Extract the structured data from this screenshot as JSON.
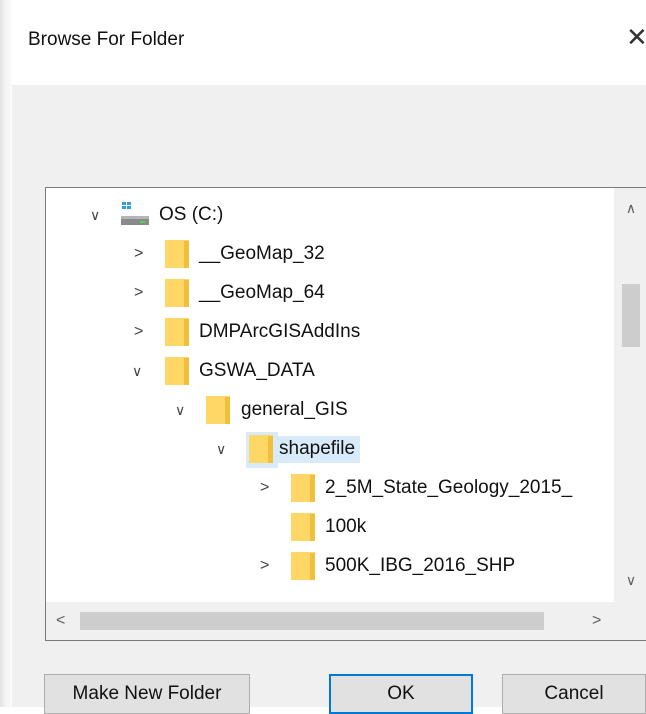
{
  "dialog": {
    "title": "Browse For Folder"
  },
  "tree": {
    "drive": {
      "label": "OS (C:)"
    },
    "items": [
      {
        "label": "__GeoMap_32"
      },
      {
        "label": "__GeoMap_64"
      },
      {
        "label": "DMPArcGISAddIns"
      },
      {
        "label": "GSWA_DATA"
      },
      {
        "label": "general_GIS"
      },
      {
        "label": "shapefile",
        "selected": true
      },
      {
        "label": "2_5M_State_Geology_2015_"
      },
      {
        "label": "100k"
      },
      {
        "label": "500K_IBG_2016_SHP"
      }
    ]
  },
  "buttons": {
    "new_folder": "Make New Folder",
    "ok": "OK",
    "cancel": "Cancel"
  },
  "icons": {
    "folder": "folder-icon",
    "drive": "drive-icon",
    "expand": "chevron-right-icon",
    "collapse": "chevron-down-icon",
    "close": "close-icon"
  },
  "colors": {
    "selection": "#d9ebf9",
    "folder": "#ffd767",
    "accent": "#0078d7"
  }
}
